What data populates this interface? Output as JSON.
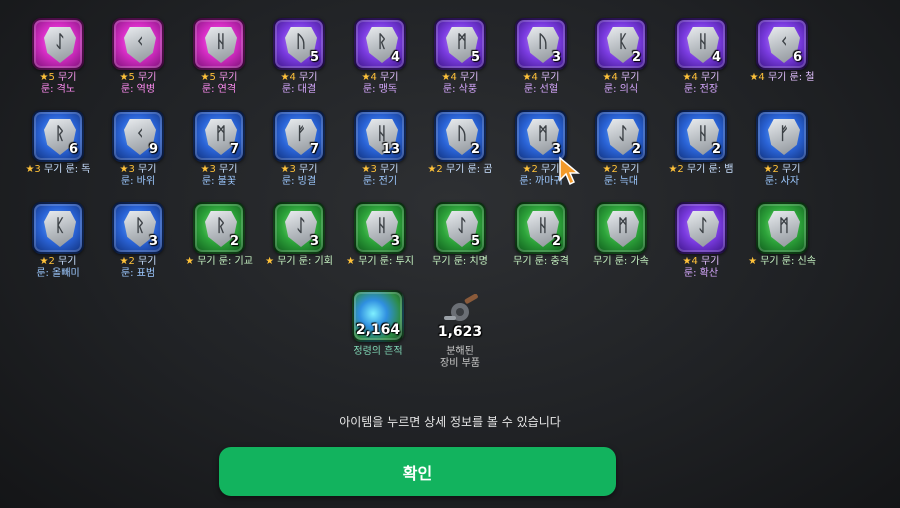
{
  "runes": [
    [
      {
        "glyph": "ᛇ",
        "color": "pink",
        "count": "",
        "line1": "★5 무기",
        "line2": "룬: 격노"
      },
      {
        "glyph": "ᚲ",
        "color": "pink",
        "count": "",
        "line1": "★5 무기",
        "line2": "룬: 역병"
      },
      {
        "glyph": "ᚺ",
        "color": "pink",
        "count": "",
        "line1": "★5 무기",
        "line2": "룬: 연격"
      },
      {
        "glyph": "ᚢ",
        "color": "purple",
        "count": "5",
        "line1": "★4 무기",
        "line2": "룬: 대결"
      },
      {
        "glyph": "ᚱ",
        "color": "purple",
        "count": "4",
        "line1": "★4 무기",
        "line2": "룬: 맹독"
      },
      {
        "glyph": "ᛗ",
        "color": "purple",
        "count": "5",
        "line1": "★4 무기",
        "line2": "룬: 삭풍"
      },
      {
        "glyph": "ᚢ",
        "color": "purple",
        "count": "3",
        "line1": "★4 무기",
        "line2": "룬: 선혈"
      },
      {
        "glyph": "ᛕ",
        "color": "purple",
        "count": "2",
        "line1": "★4 무기",
        "line2": "룬: 의식"
      },
      {
        "glyph": "ᚺ",
        "color": "purple",
        "count": "4",
        "line1": "★4 무기",
        "line2": "룬: 전장"
      },
      {
        "glyph": "ᚲ",
        "color": "purple",
        "count": "6",
        "line1": "★4 무기 룬: 철",
        "line2": ""
      }
    ],
    [
      {
        "glyph": "ᚱ",
        "color": "blue",
        "count": "6",
        "line1": "★3 무기 룬: 독",
        "line2": ""
      },
      {
        "glyph": "ᚲ",
        "color": "blue",
        "count": "9",
        "line1": "★3 무기",
        "line2": "룬: 바위"
      },
      {
        "glyph": "ᛗ",
        "color": "blue",
        "count": "7",
        "line1": "★3 무기",
        "line2": "룬: 불꽃"
      },
      {
        "glyph": "ᚠ",
        "color": "blue",
        "count": "7",
        "line1": "★3 무기",
        "line2": "룬: 빙결"
      },
      {
        "glyph": "ᚺ",
        "color": "blue",
        "count": "13",
        "line1": "★3 무기",
        "line2": "룬: 전기"
      },
      {
        "glyph": "ᚢ",
        "color": "blue",
        "count": "2",
        "line1": "★2 무기 룬: 곰",
        "line2": ""
      },
      {
        "glyph": "ᛗ",
        "color": "blue",
        "count": "3",
        "line1": "★2 무기",
        "line2": "룬: 까마귀"
      },
      {
        "glyph": "ᛇ",
        "color": "blue",
        "count": "2",
        "line1": "★2 무기",
        "line2": "룬: 늑대"
      },
      {
        "glyph": "ᚺ",
        "color": "blue",
        "count": "2",
        "line1": "★2 무기 룬: 뱀",
        "line2": ""
      },
      {
        "glyph": "ᚠ",
        "color": "blue",
        "count": "",
        "line1": "★2 무기",
        "line2": "룬: 사자"
      }
    ],
    [
      {
        "glyph": "ᛕ",
        "color": "blue",
        "count": "",
        "line1": "★2 무기",
        "line2": "룬: 올빼미"
      },
      {
        "glyph": "ᚱ",
        "color": "blue",
        "count": "3",
        "line1": "★2 무기",
        "line2": "룬: 표범"
      },
      {
        "glyph": "ᚱ",
        "color": "green",
        "count": "2",
        "line1": "★ 무기 룬: 기교",
        "line2": ""
      },
      {
        "glyph": "ᛇ",
        "color": "green",
        "count": "3",
        "line1": "★ 무기 룬: 기회",
        "line2": ""
      },
      {
        "glyph": "ᚺ",
        "color": "green",
        "count": "3",
        "line1": "★ 무기 룬: 투지",
        "line2": ""
      },
      {
        "glyph": "ᛇ",
        "color": "green",
        "count": "5",
        "line1": "무기 룬: 치명",
        "line2": ""
      },
      {
        "glyph": "ᚺ",
        "color": "green",
        "count": "2",
        "line1": "무기 룬: 충격",
        "line2": ""
      },
      {
        "glyph": "ᛗ",
        "color": "green",
        "count": "",
        "line1": "무기 룬: 가속",
        "line2": ""
      },
      {
        "glyph": "ᛇ",
        "color": "purple",
        "count": "",
        "line1": "★4 무기",
        "line2": "룬: 확산"
      },
      {
        "glyph": "ᛗ",
        "color": "green",
        "count": "",
        "line1": "★ 무기 룬: 신속",
        "line2": ""
      }
    ]
  ],
  "extras": {
    "essence": {
      "count": "2,164",
      "label": "정령의 흔적"
    },
    "parts": {
      "count": "1,623",
      "label1": "분해된",
      "label2": "장비 부품"
    }
  },
  "hint": "아이템을 누르면 상세 정보를 볼 수 있습니다",
  "confirm_label": "확인"
}
